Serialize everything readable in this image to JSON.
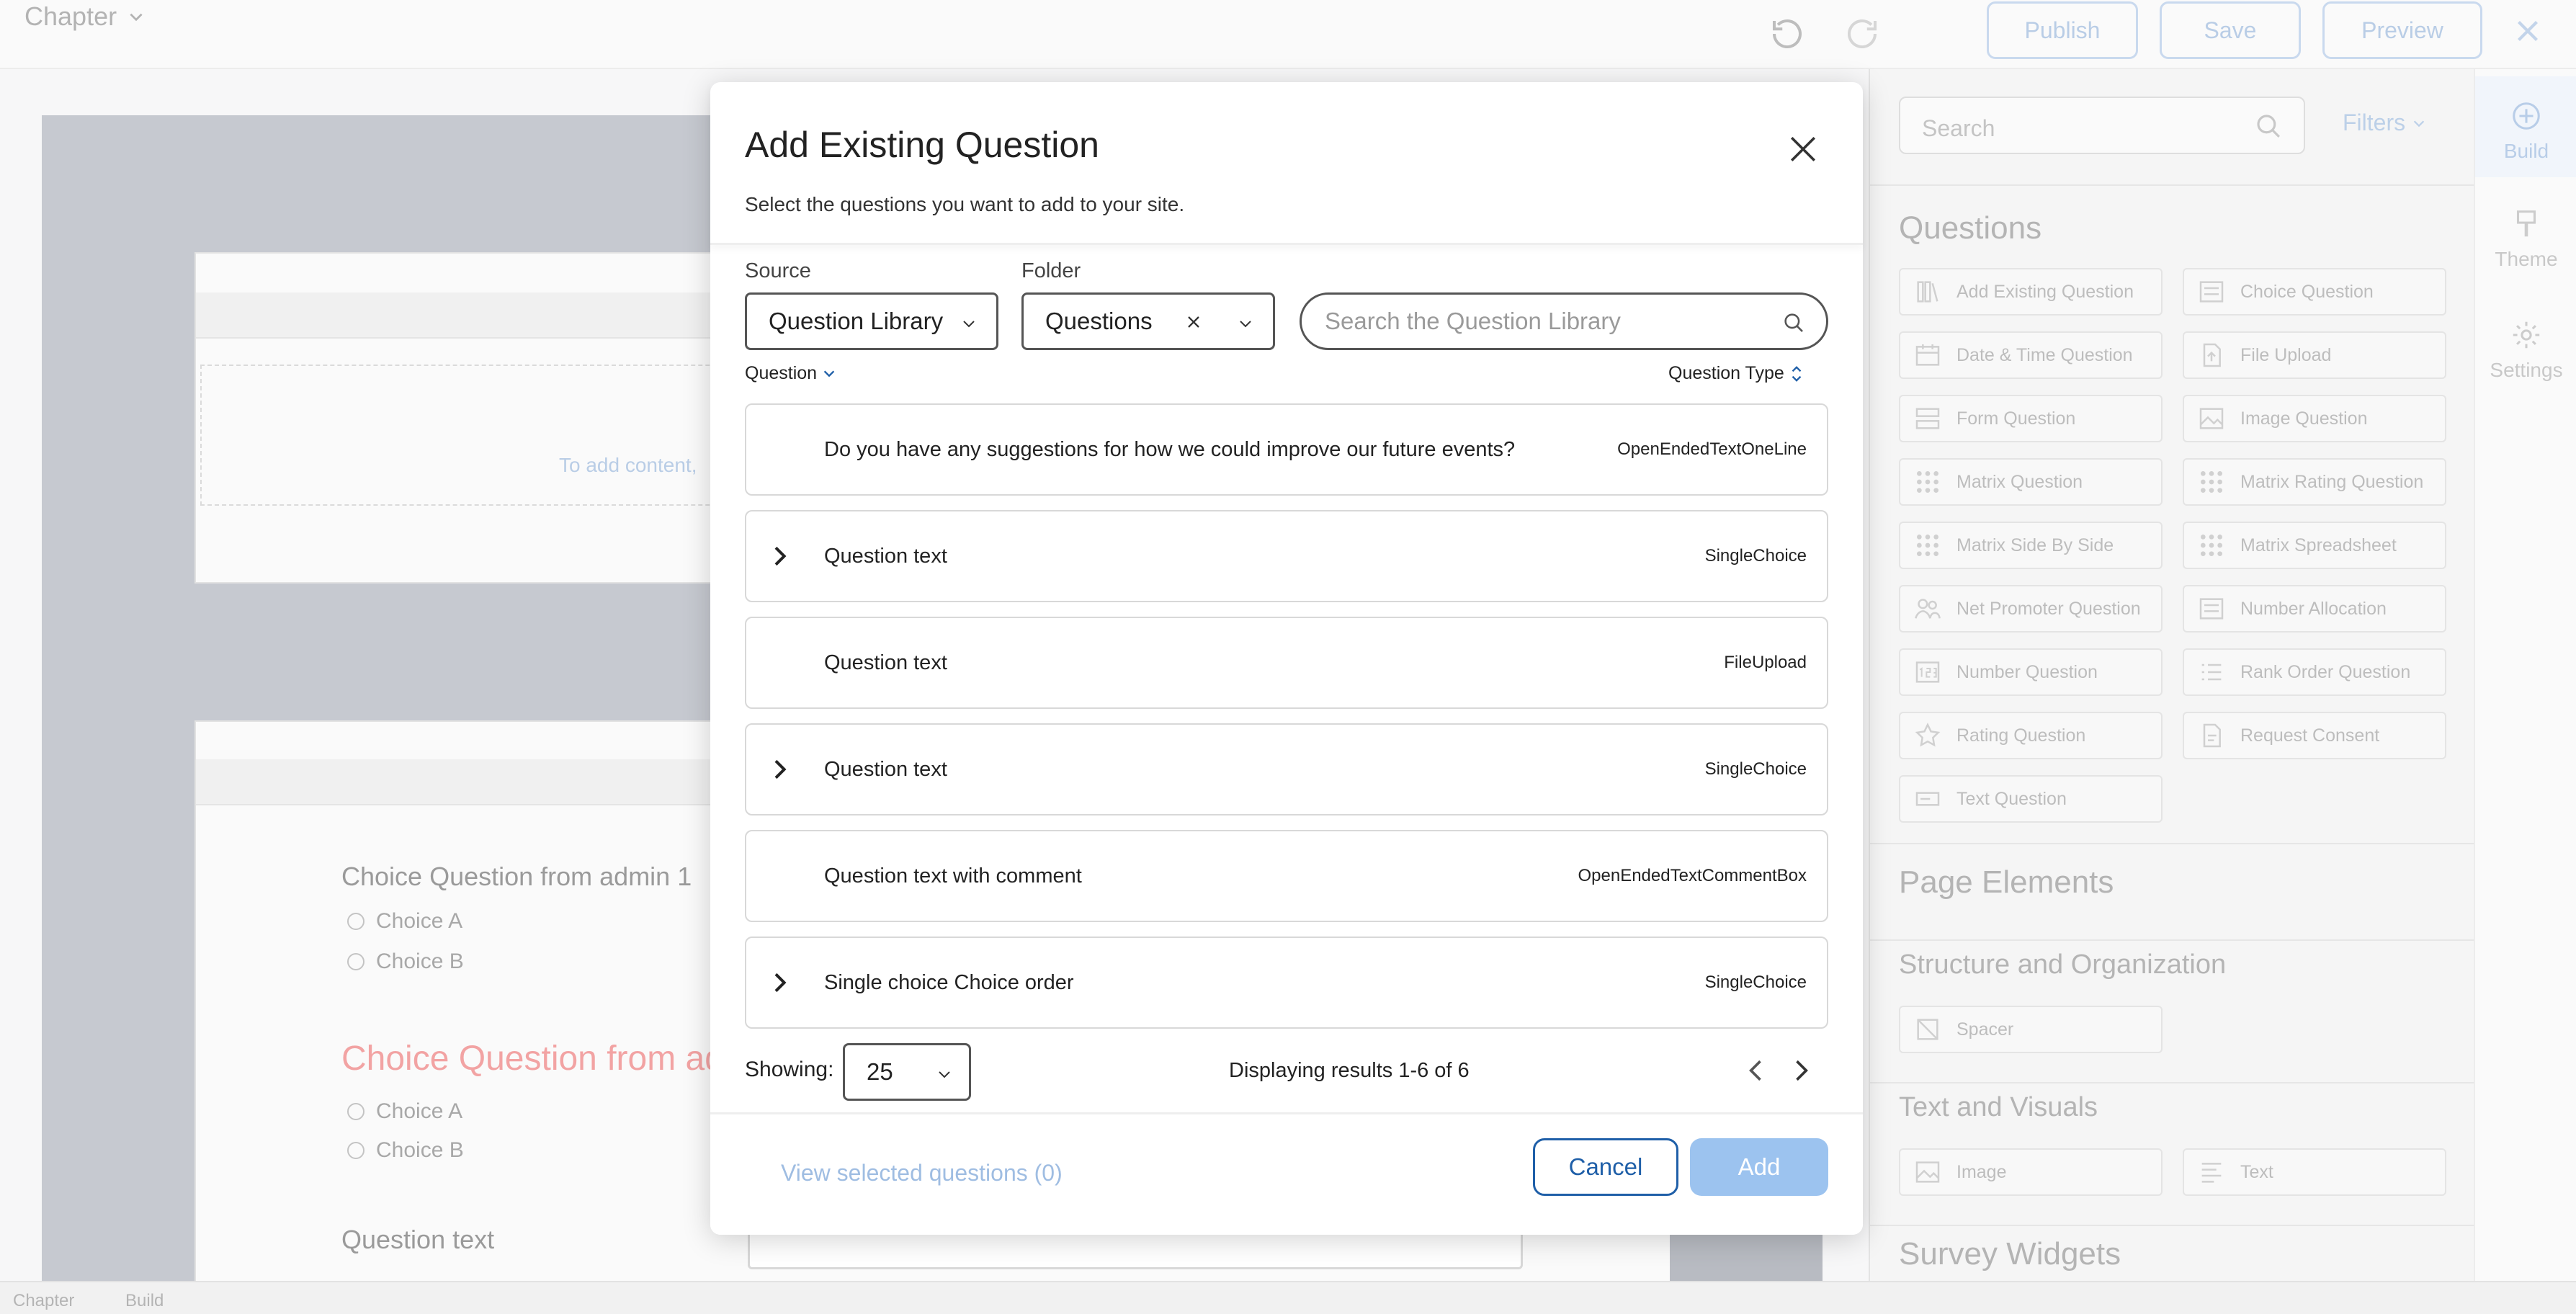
{
  "topbar": {
    "chapter_label": "Chapter",
    "publish_label": "Publish",
    "save_label": "Save",
    "preview_label": "Preview"
  },
  "canvas": {
    "hint": "To add content,",
    "q1_title": "Choice Question from admin 1",
    "q1_choices": [
      "Choice A",
      "Choice B"
    ],
    "q2_title": "Choice Question from ad",
    "q2_choices": [
      "Choice A",
      "Choice B"
    ],
    "q3_title": "Question text"
  },
  "panel": {
    "search_placeholder": "Search",
    "filters_label": "Filters",
    "questions_heading": "Questions",
    "question_tiles": [
      {
        "label": "Add Existing Question",
        "icon": "library-icon"
      },
      {
        "label": "Choice Question",
        "icon": "list-icon"
      },
      {
        "label": "Date & Time Question",
        "icon": "calendar-icon"
      },
      {
        "label": "File Upload",
        "icon": "upload-icon"
      },
      {
        "label": "Form Question",
        "icon": "form-icon"
      },
      {
        "label": "Image Question",
        "icon": "image-icon"
      },
      {
        "label": "Matrix Question",
        "icon": "grid-icon"
      },
      {
        "label": "Matrix Rating Question",
        "icon": "grid-icon"
      },
      {
        "label": "Matrix Side By Side",
        "icon": "grid-icon"
      },
      {
        "label": "Matrix Spreadsheet",
        "icon": "grid-icon"
      },
      {
        "label": "Net Promoter Question",
        "icon": "people-icon"
      },
      {
        "label": "Number Allocation",
        "icon": "list-icon"
      },
      {
        "label": "Number Question",
        "icon": "number-icon"
      },
      {
        "label": "Rank Order Question",
        "icon": "rank-icon"
      },
      {
        "label": "Rating Question",
        "icon": "star-icon"
      },
      {
        "label": "Request Consent",
        "icon": "document-icon"
      },
      {
        "label": "Text Question",
        "icon": "text-field-icon"
      }
    ],
    "page_elements_heading": "Page Elements",
    "structure_heading": "Structure and Organization",
    "structure_tiles": [
      {
        "label": "Spacer",
        "icon": "spacer-icon"
      }
    ],
    "text_visuals_heading": "Text and Visuals",
    "text_visual_tiles": [
      {
        "label": "Image",
        "icon": "image-icon"
      },
      {
        "label": "Text",
        "icon": "text-icon"
      }
    ],
    "survey_widgets_heading": "Survey Widgets"
  },
  "rail": {
    "build_label": "Build",
    "theme_label": "Theme",
    "settings_label": "Settings"
  },
  "statusbar": {
    "left": "Chapter",
    "right": "Build"
  },
  "modal": {
    "title": "Add Existing Question",
    "subtitle": "Select the questions you want to add to your site.",
    "source_label": "Source",
    "source_value": "Question Library",
    "folder_label": "Folder",
    "folder_value": "Questions",
    "search_placeholder": "Search the Question Library",
    "col_question": "Question",
    "col_type": "Question Type",
    "rows": [
      {
        "text": "Do you have any suggestions for how we could improve our future events?",
        "type": "OpenEndedTextOneLine",
        "expandable": false
      },
      {
        "text": "Question text",
        "type": "SingleChoice",
        "expandable": true
      },
      {
        "text": "Question text",
        "type": "FileUpload",
        "expandable": false
      },
      {
        "text": "Question text",
        "type": "SingleChoice",
        "expandable": true
      },
      {
        "text": "Question text with comment",
        "type": "OpenEndedTextCommentBox",
        "expandable": false
      },
      {
        "text": "Single choice Choice order",
        "type": "SingleChoice",
        "expandable": true
      }
    ],
    "showing_label": "Showing:",
    "page_size": "25",
    "results_text": "Displaying results 1-6 of 6",
    "view_selected": "View selected questions (0)",
    "cancel_label": "Cancel",
    "add_label": "Add"
  }
}
